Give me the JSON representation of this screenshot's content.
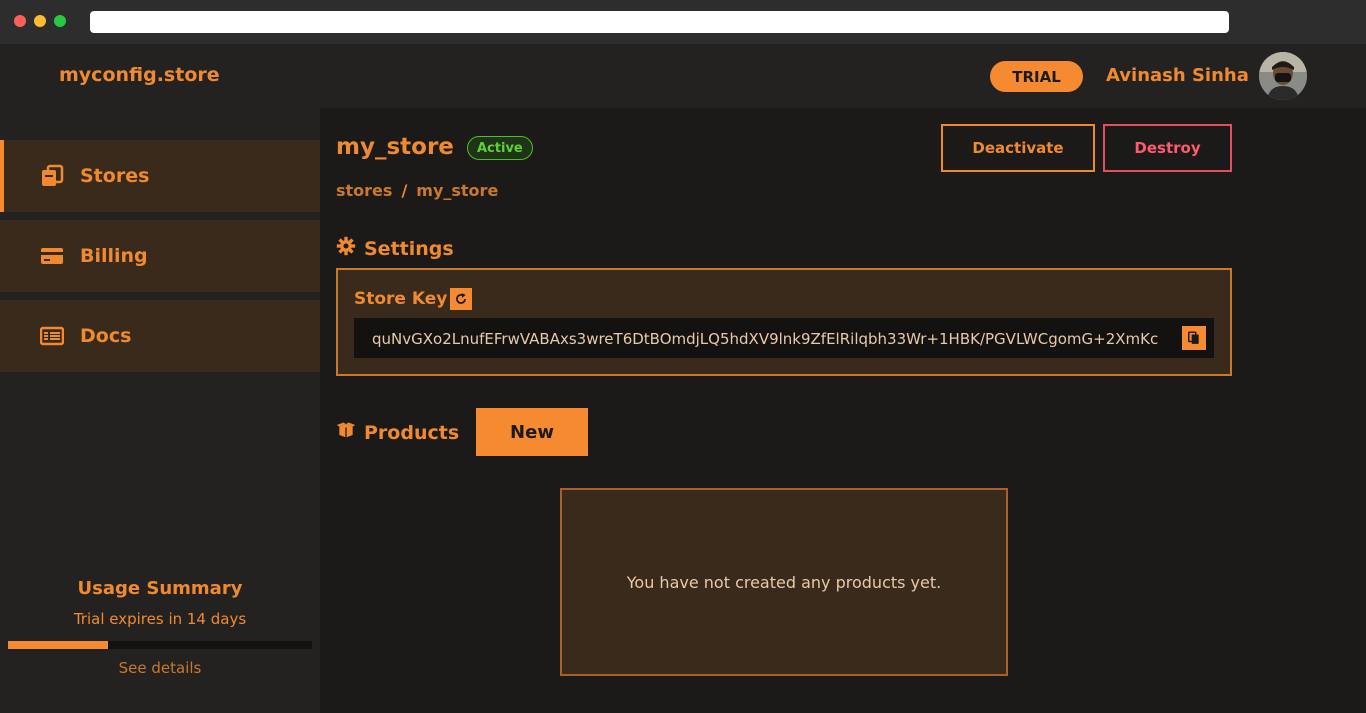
{
  "header": {
    "brand": "myconfig.store",
    "trial_label": "TRIAL",
    "user_name": "Avinash Sinha"
  },
  "sidebar": {
    "items": [
      {
        "label": "Stores",
        "icon": "stores-icon",
        "active": true
      },
      {
        "label": "Billing",
        "icon": "billing-card-icon",
        "active": false
      },
      {
        "label": "Docs",
        "icon": "docs-icon",
        "active": false
      }
    ],
    "usage": {
      "title": "Usage Summary",
      "subtitle": "Trial expires in 14 days",
      "progress_fraction": 0.33,
      "details_label": "See details"
    }
  },
  "main": {
    "store_name": "my_store",
    "status": "Active",
    "deactivate_label": "Deactivate",
    "destroy_label": "Destroy",
    "breadcrumb": [
      "stores",
      "my_store"
    ],
    "settings_title": "Settings",
    "store_key_label": "Store Key",
    "store_key_value": "quNvGXo2LnufEFrwVABAxs3wreT6DtBOmdjLQ5hdXV9lnk9ZfElRilqbh33Wr+1HBK/PGVLWCgomG+2XmKc",
    "products_title": "Products",
    "new_label": "New",
    "empty_message": "You have not created any products yet."
  },
  "colors": {
    "accent": "#f58a30",
    "background": "#1c1a18",
    "panel": "#3a2a1b",
    "active_status": "#5ed235",
    "danger": "#ff5a6e"
  }
}
